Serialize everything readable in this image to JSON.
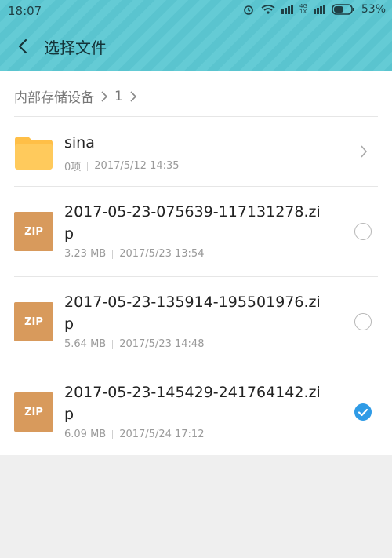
{
  "status": {
    "time": "18:07",
    "signal_left": "4G",
    "signal_right": "1X",
    "battery": "53%"
  },
  "appbar": {
    "title": "选择文件"
  },
  "breadcrumb": {
    "root": "内部存储设备",
    "current": "1"
  },
  "items": [
    {
      "type": "folder",
      "name": "sina",
      "count": "0项",
      "date": "2017/5/12 14:35"
    },
    {
      "type": "zip",
      "thumb_label": "ZIP",
      "name_line1": "2017-05-23-075639-117131278.zi",
      "name_line2": "p",
      "size": "3.23 MB",
      "date": "2017/5/23 13:54",
      "selected": false
    },
    {
      "type": "zip",
      "thumb_label": "ZIP",
      "name_line1": "2017-05-23-135914-195501976.zi",
      "name_line2": "p",
      "size": "5.64 MB",
      "date": "2017/5/23 14:48",
      "selected": false
    },
    {
      "type": "zip",
      "thumb_label": "ZIP",
      "name_line1": "2017-05-23-145429-241764142.zi",
      "name_line2": "p",
      "size": "6.09 MB",
      "date": "2017/5/24 17:12",
      "selected": true
    }
  ],
  "icons": {
    "back": "back-arrow-icon",
    "folder": "folder-icon",
    "chevron": "chevron-right-icon",
    "check": "checkmark-icon"
  },
  "colors": {
    "header": "#5cc8d3",
    "zip": "#d89a5c",
    "folder": "#ffbf47",
    "selected": "#2f9be6"
  }
}
